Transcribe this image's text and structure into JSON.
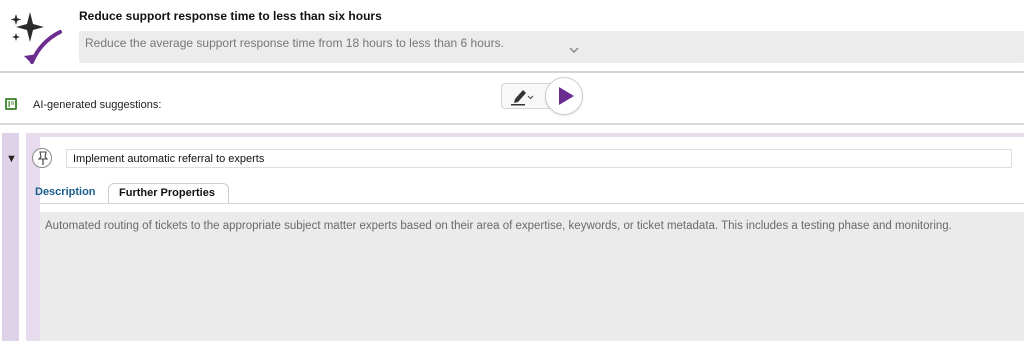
{
  "goal": {
    "title": "Reduce support response time to less than six hours",
    "description": "Reduce the average support response time from 18 hours to less than 6 hours.",
    "icon": "sparkle-arrow-icon"
  },
  "suggestions": {
    "label": "AI-generated suggestions:",
    "icon": "book-icon"
  },
  "toolbar": {
    "edit_icon": "pen-edit-icon",
    "play_icon": "play-icon"
  },
  "suggestion": {
    "title": "Implement automatic referral to experts",
    "collapse_glyph": "▼",
    "tabs": [
      {
        "label": "Description"
      },
      {
        "label": "Further Properties"
      }
    ],
    "description": "Automated routing of tickets to the appropriate subject matter experts based on their area of expertise, keywords, or ticket metadata. This includes a testing phase and monitoring."
  },
  "colors": {
    "accent_purple": "#6a2d8f",
    "card_rail": "#e6dced",
    "tab_active": "#1b5e8c"
  }
}
